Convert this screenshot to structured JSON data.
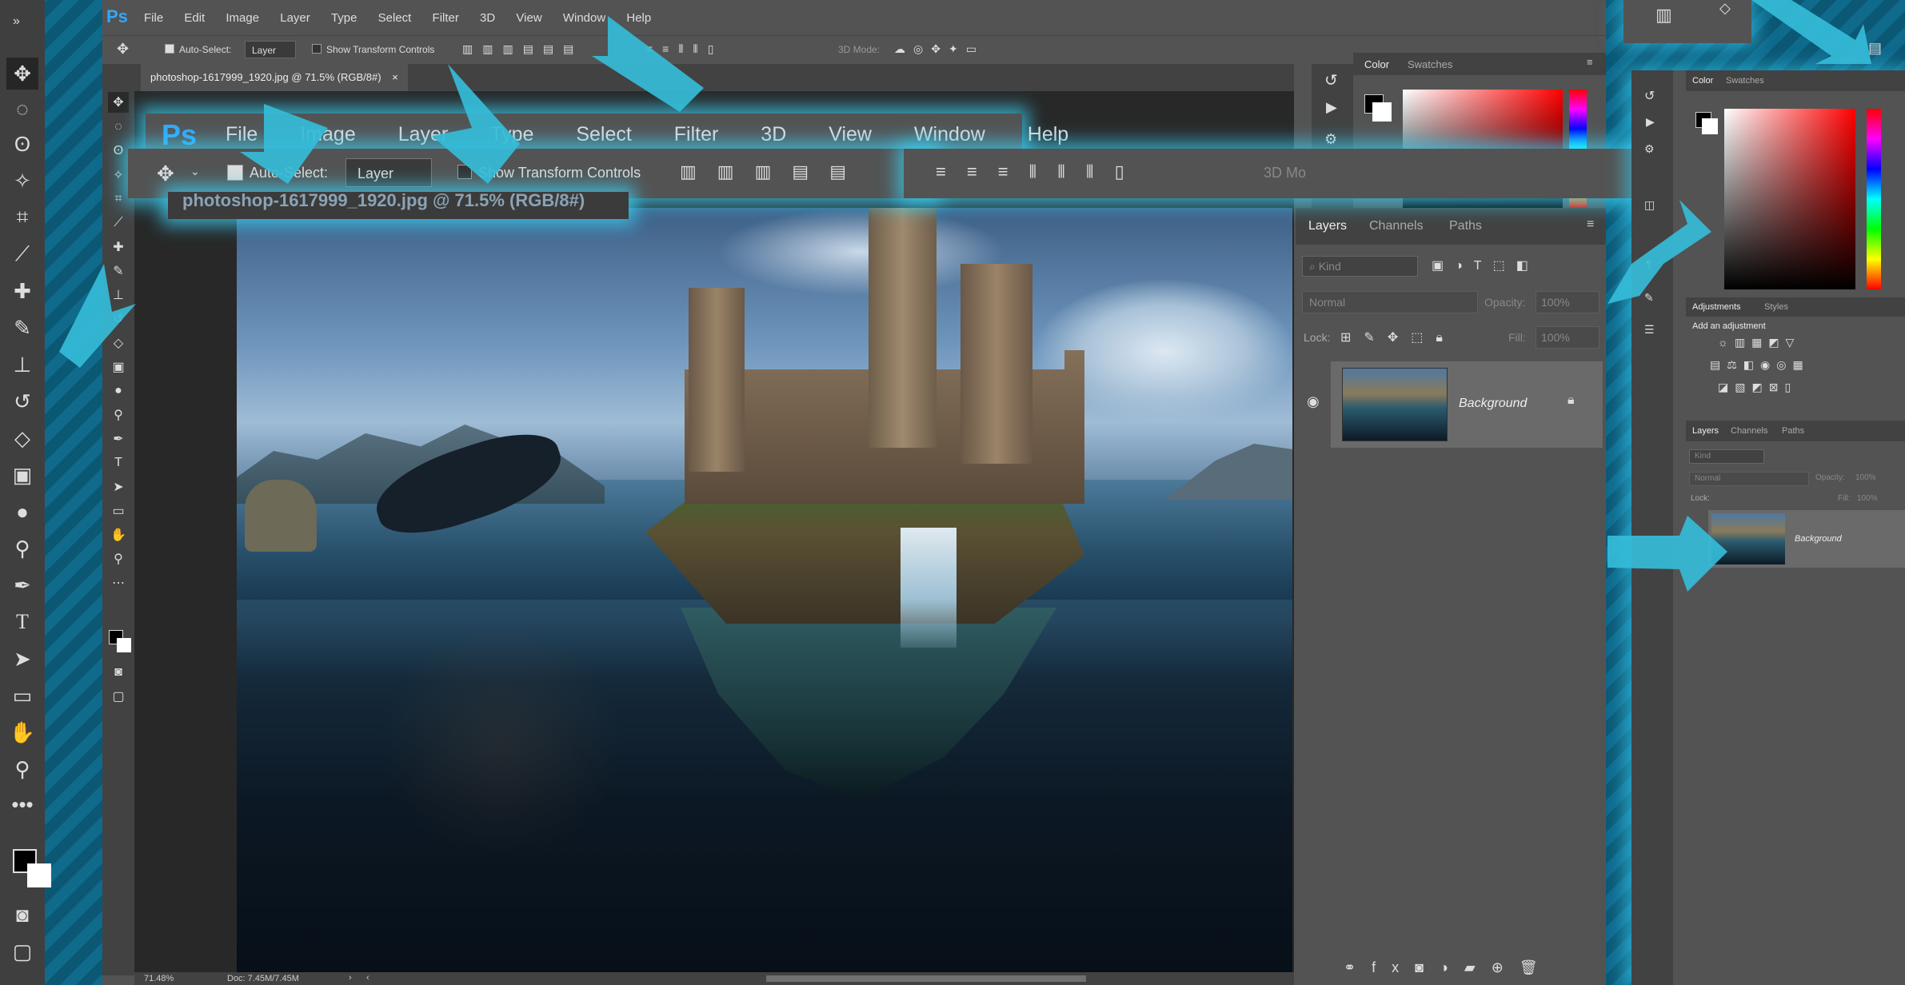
{
  "app": {
    "logo": "Ps"
  },
  "menu": [
    "File",
    "Edit",
    "Image",
    "Layer",
    "Type",
    "Select",
    "Filter",
    "3D",
    "View",
    "Window",
    "Help"
  ],
  "zoom_menu": [
    "File",
    "Image",
    "Layer",
    "Type",
    "Select",
    "Filter",
    "3D",
    "View",
    "Window",
    "Help"
  ],
  "options": {
    "auto_select_label": "Auto-Select:",
    "auto_select_value": "Layer",
    "transform_label": "Show Transform Controls",
    "mode3d_label": "3D Mode:",
    "mode3d_short": "3D Mo"
  },
  "document": {
    "tab_title": "photoshop-1617999_1920.jpg @ 71.5% (RGB/8#)",
    "zoom_tab_title": "photoshop-1617999_1920.jpg @ 71.5% (RGB/8#)"
  },
  "status": {
    "zoom": "71.48%",
    "doc": "Doc: 7.45M/7.45M"
  },
  "color_panel": {
    "tabs": [
      "Color",
      "Swatches"
    ],
    "foreground": "#000000",
    "background": "#ffffff"
  },
  "layers_panel": {
    "tabs": [
      "Layers",
      "Channels",
      "Paths"
    ],
    "kind_placeholder": "Kind",
    "blend_mode": "Normal",
    "opacity_label": "Opacity:",
    "opacity_value": "100%",
    "lock_label": "Lock:",
    "fill_label": "Fill:",
    "fill_value": "100%",
    "layer_name": "Background"
  },
  "adjustments_panel": {
    "tabs": [
      "Adjustments",
      "Styles"
    ],
    "hint": "Add an adjustment"
  },
  "colors": {
    "accent": "#31a8ff",
    "glow": "#3cd2f5",
    "panel": "#535353",
    "canvas_bg": "#282828"
  }
}
